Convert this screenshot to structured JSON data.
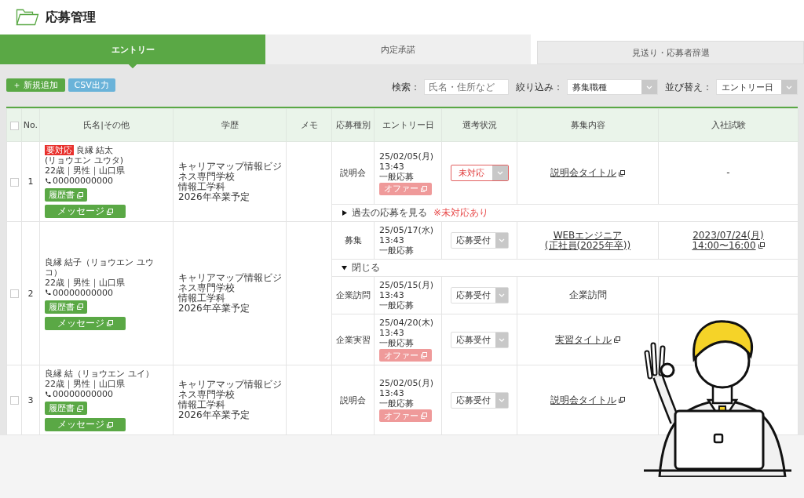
{
  "header": {
    "title": "応募管理"
  },
  "tabs": [
    {
      "label": "エントリー",
      "selected": true
    },
    {
      "label": "内定承諾",
      "selected": false
    },
    {
      "label": "見送り・応募者辞退",
      "selected": false
    }
  ],
  "toolbar": {
    "add_button": "＋ 新規追加",
    "csv_button": "CSV出力",
    "search": {
      "label": "検索：",
      "placeholder": "氏名・住所など"
    },
    "filter": {
      "label": "絞り込み：",
      "value": "募集職種"
    },
    "sort": {
      "label": "並び替え：",
      "value": "エントリー日"
    }
  },
  "table": {
    "header_checked": false,
    "columns": [
      "No.",
      "氏名|その他",
      "学歴",
      "メモ",
      "応募種別",
      "エントリー日",
      "選考状況",
      "募集内容",
      "入社試験"
    ],
    "rows": [
      {
        "checked": false,
        "no": "1",
        "badge": "要対応",
        "name": "良縁 結太",
        "reading": "(リョウエン ユウタ)",
        "details": "22歳｜男性｜山口県",
        "phone": "00000000000",
        "resume_button": "履歴書",
        "message_button": "メッセージ",
        "education": [
          "キャリアマップ情報ビジネス専門学校",
          "情報工学科",
          "2026年卒業予定"
        ],
        "entries": [
          {
            "type": "説明会",
            "date": "25/02/05(月)",
            "time": "13:43",
            "route": "一般応募",
            "offer_button": "オファー",
            "status": {
              "value": "未対応",
              "alert": true
            },
            "job": {
              "lines": [
                "説明会タイトル"
              ],
              "link": true,
              "external": true
            },
            "exam": {
              "lines": [
                "-"
              ],
              "link": false,
              "external": false
            }
          }
        ],
        "toggle": {
          "expanded": false,
          "label": "過去の応募を見る",
          "note": "※未対応あり"
        }
      },
      {
        "checked": false,
        "no": "2",
        "name": "良縁 結子（リョウエン ユウコ）",
        "details": "22歳｜男性｜山口県",
        "phone": "00000000000",
        "resume_button": "履歴書",
        "message_button": "メッセージ",
        "education": [
          "キャリアマップ情報ビジネス専門学校",
          "情報工学科",
          "2026年卒業予定"
        ],
        "entries": [
          {
            "type": "募集",
            "date": "25/05/17(水)",
            "time": "13:43",
            "route": "一般応募",
            "status": {
              "value": "応募受付",
              "alert": false
            },
            "job": {
              "lines": [
                "WEBエンジニア",
                "(正社員(2025年卒))"
              ],
              "link": true,
              "external": false
            },
            "exam": {
              "lines": [
                "2023/07/24(月)",
                "14:00〜16:00"
              ],
              "link": true,
              "external": true
            }
          }
        ],
        "toggle": {
          "expanded": true,
          "label": "閉じる"
        },
        "history": [
          {
            "type": "企業訪問",
            "date": "25/05/15(月)",
            "time": "13:43",
            "route": "一般応募",
            "status": {
              "value": "応募受付",
              "alert": false
            },
            "job": {
              "lines": [
                "企業訪問"
              ],
              "link": false,
              "external": false
            }
          },
          {
            "type": "企業実習",
            "date": "25/04/20(木)",
            "time": "13:43",
            "route": "一般応募",
            "offer_button": "オファー",
            "status": {
              "value": "応募受付",
              "alert": false
            },
            "job": {
              "lines": [
                "実習タイトル"
              ],
              "link": true,
              "external": true
            }
          }
        ]
      },
      {
        "checked": false,
        "no": "3",
        "name": "良縁 結（リョウエン ユイ）",
        "details": "22歳｜男性｜山口県",
        "phone": "00000000000",
        "resume_button": "履歴書",
        "message_button": "メッセージ",
        "education": [
          "キャリアマップ情報ビジネス専門学校",
          "情報工学科",
          "2026年卒業予定"
        ],
        "entries": [
          {
            "type": "説明会",
            "date": "25/02/05(月)",
            "time": "13:43",
            "route": "一般応募",
            "offer_button": "オファー",
            "status": {
              "value": "応募受付",
              "alert": false
            },
            "job": {
              "lines": [
                "説明会タイトル"
              ],
              "link": true,
              "external": true
            }
          }
        ]
      }
    ]
  }
}
